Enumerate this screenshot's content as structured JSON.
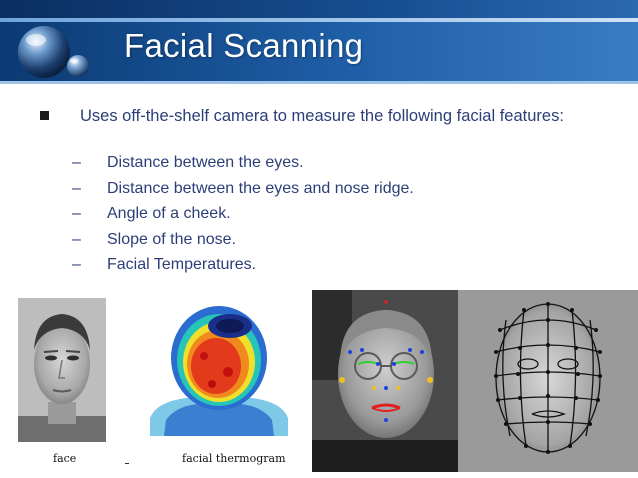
{
  "slide": {
    "title": "Facial Scanning",
    "bullet": "Uses off-the-shelf camera to measure the following facial features:",
    "sub_items": [
      "Distance between the eyes.",
      "Distance between the eyes and nose ridge.",
      "Angle of a cheek.",
      "Slope of the nose.",
      "Facial Temperatures."
    ],
    "dash": "–"
  },
  "figures": {
    "face_caption": "face",
    "thermogram_caption": "facial thermogram"
  },
  "colors": {
    "header": "#1f5fa8",
    "text": "#2c3e78",
    "title": "#ffffff"
  }
}
